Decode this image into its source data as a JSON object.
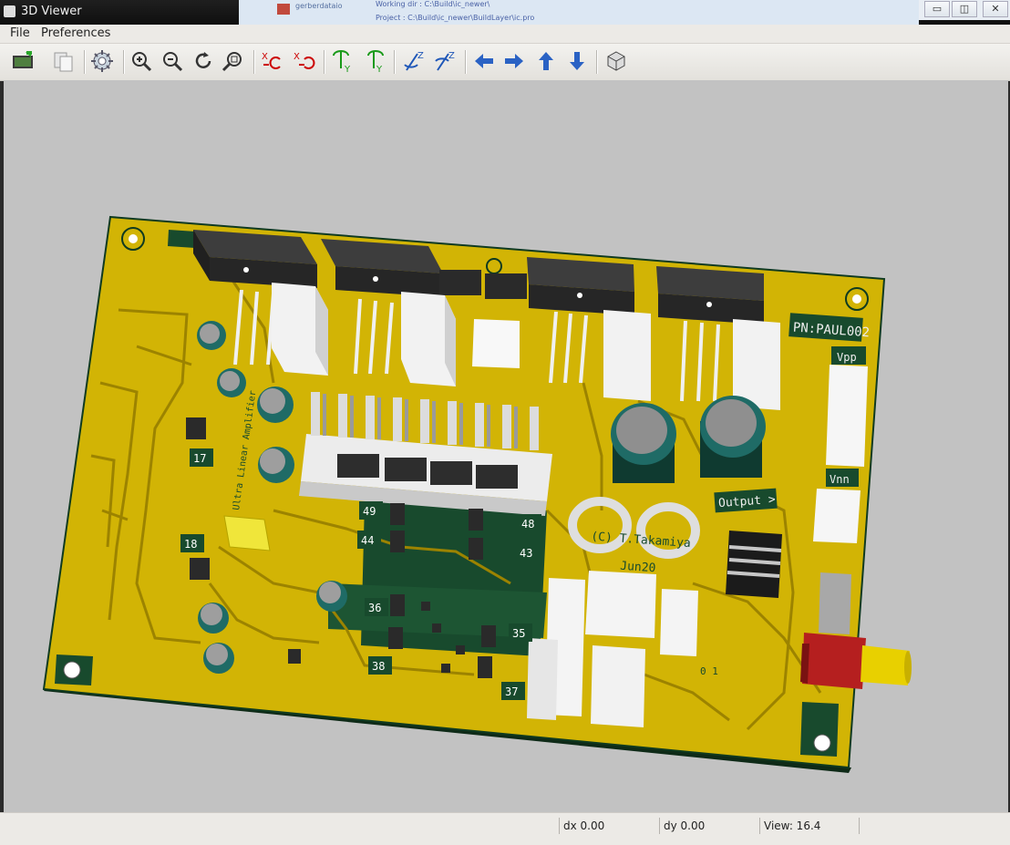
{
  "window": {
    "title": "3D Viewer"
  },
  "background_app": {
    "tab": "gerberdataio",
    "working_dir": "Working dir : C:\\Build\\ic_newer\\",
    "project": "Project : C:\\Build\\ic_newer\\BuildLayer\\ic.pro"
  },
  "menu": {
    "items": [
      "File",
      "Preferences"
    ]
  },
  "toolbar": {
    "tools": [
      "reload-board-icon",
      "copy-to-clipboard-icon",
      "settings-icon",
      "zoom-in-icon",
      "zoom-out-icon",
      "redraw-icon",
      "zoom-fit-icon",
      "rotate-x-cw-icon",
      "rotate-x-ccw-icon",
      "rotate-y-cw-icon",
      "rotate-y-ccw-icon",
      "rotate-z-cw-icon",
      "rotate-z-ccw-icon",
      "move-left-icon",
      "move-right-icon",
      "move-up-icon",
      "move-down-icon",
      "ortho-view-icon"
    ]
  },
  "board": {
    "part_number": "PN:PAUL002",
    "silk_vnn": "Vnn",
    "silk_vpp": "Vpp",
    "silk_output": "Output >",
    "silk_copyright": "(C) T.Takamiya",
    "silk_date": "Jun20",
    "silk_title": "Ultra Linear Amplifier",
    "silk_jumper": "0 1",
    "ref_labels": [
      "17",
      "18",
      "49",
      "48",
      "44",
      "43",
      "36",
      "35",
      "38",
      "37"
    ],
    "colors": {
      "board": "#d2b405",
      "mask": "#184a2d",
      "viewport": "#c2c2c2"
    }
  },
  "status": {
    "dx": "dx 0.00",
    "dy": "dy 0.00",
    "view": "View: 16.4"
  }
}
